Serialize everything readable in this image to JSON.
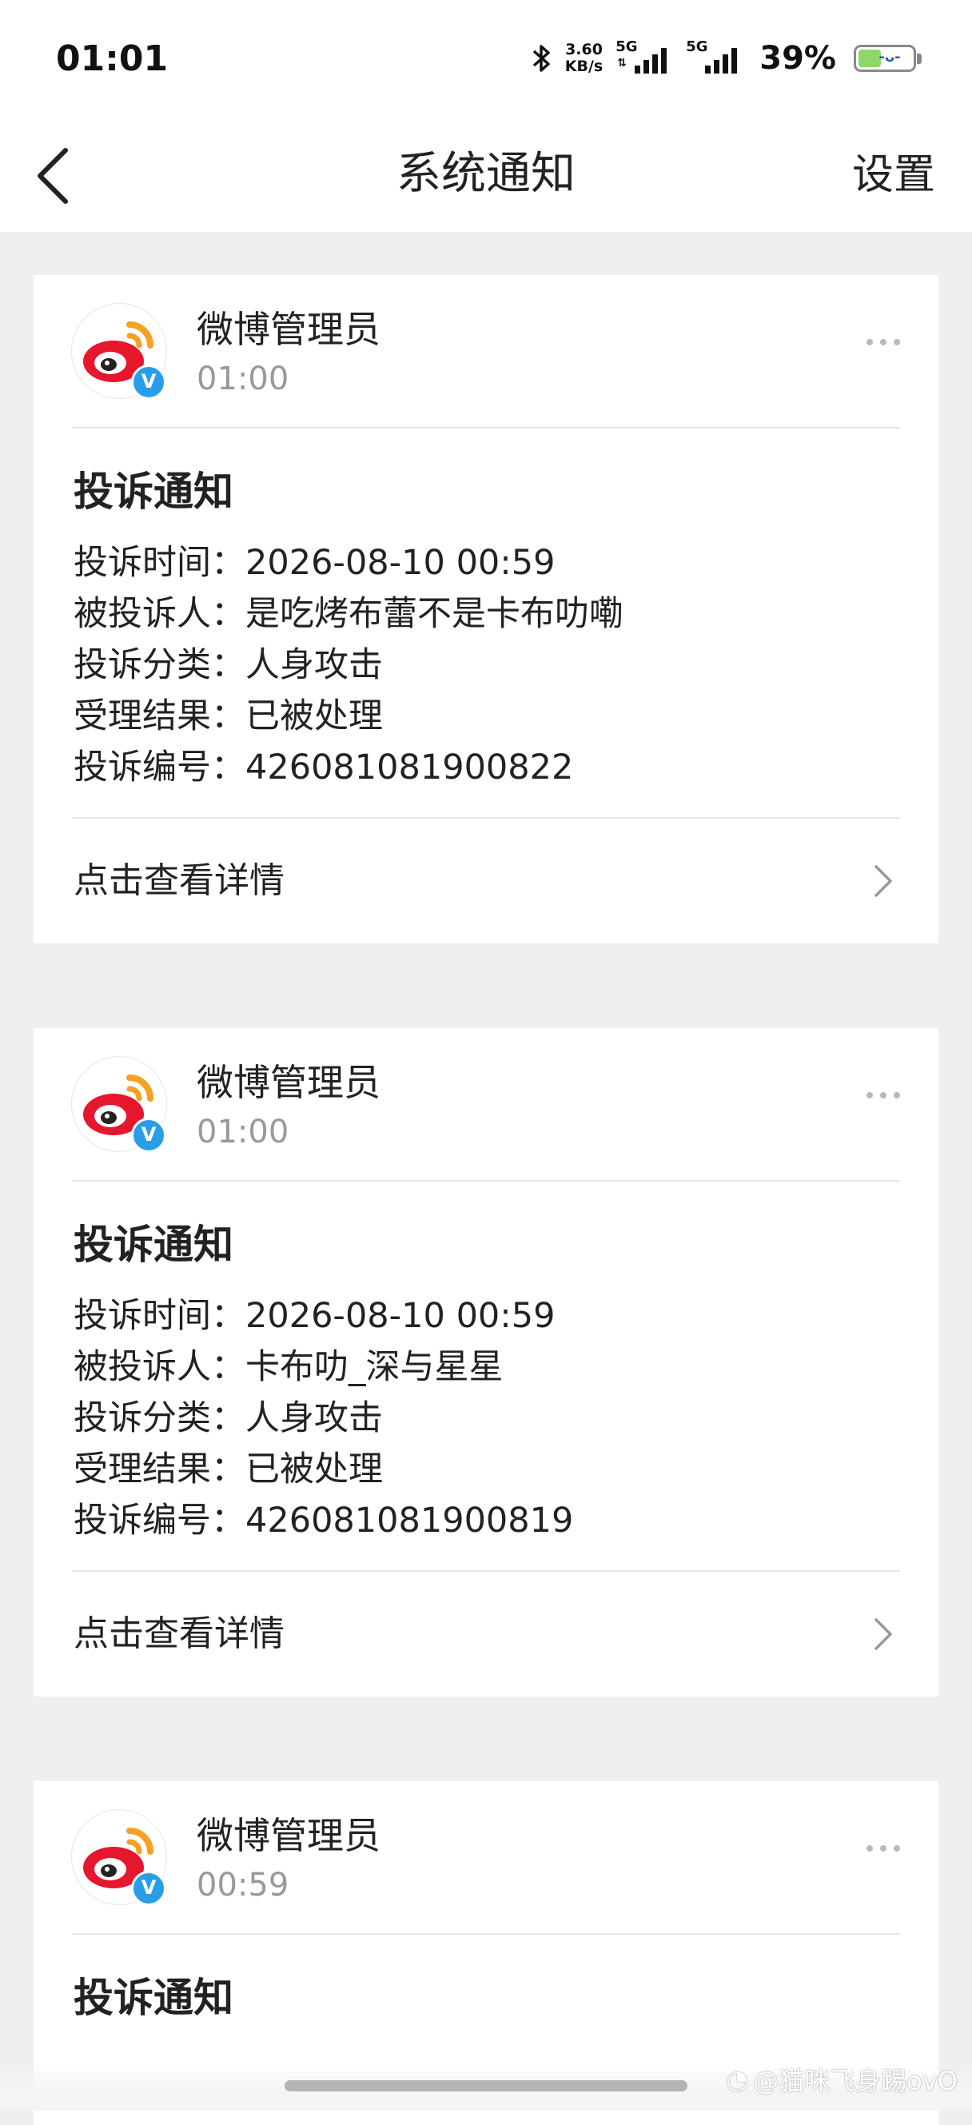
{
  "status_bar": {
    "time": "01:01",
    "net_speed_value": "3.60",
    "net_speed_unit": "KB/s",
    "signal1_label": "5G",
    "signal2_label": "5G",
    "battery_percent": "39%"
  },
  "nav": {
    "title": "系统通知",
    "settings_label": "设置"
  },
  "notifications": [
    {
      "sender": "微博管理员",
      "time": "01:00",
      "title": "投诉通知",
      "lines": [
        "投诉时间：2026-08-10 00:59",
        "被投诉人：是吃烤布蕾不是卡布叻嘞",
        "投诉分类：人身攻击",
        "受理结果：已被处理",
        "投诉编号：426081081900822"
      ],
      "detail_label": "点击查看详情"
    },
    {
      "sender": "微博管理员",
      "time": "01:00",
      "title": "投诉通知",
      "lines": [
        "投诉时间：2026-08-10 00:59",
        "被投诉人：卡布叻_深与星星",
        "投诉分类：人身攻击",
        "受理结果：已被处理",
        "投诉编号：426081081900819"
      ],
      "detail_label": "点击查看详情"
    },
    {
      "sender": "微博管理员",
      "time": "00:59",
      "title": "投诉通知"
    }
  ],
  "watermark": "@猫咪飞身踢ovO",
  "colors": {
    "page_bg": "#efefef",
    "card_bg": "#ffffff",
    "muted_text": "#999999",
    "verify_badge": "#2a9de8",
    "weibo_red": "#e6162d",
    "weibo_orange": "#f6a123"
  }
}
